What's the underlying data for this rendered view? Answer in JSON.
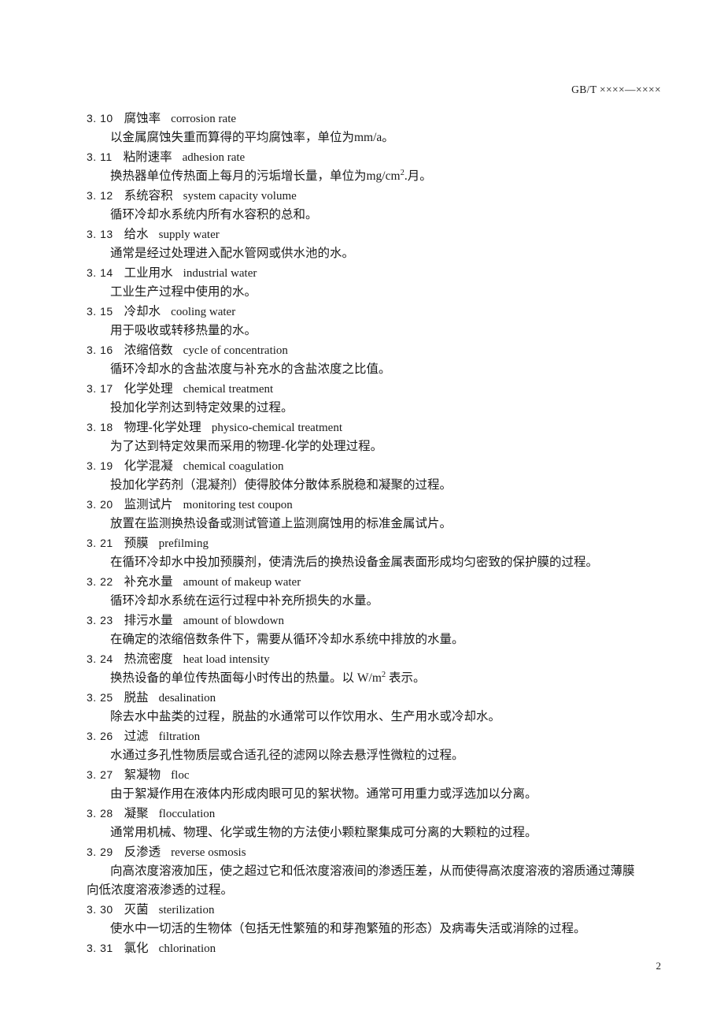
{
  "header": {
    "standard_code": "GB/T ××××—××××"
  },
  "footer": {
    "page_number": "2"
  },
  "entries": [
    {
      "number": "3. 10",
      "term_cn": "腐蚀率",
      "term_en": "corrosion rate",
      "definition_lines": [
        "以金属腐蚀失重而算得的平均腐蚀率，单位为mm/a。"
      ]
    },
    {
      "number": "3. 11",
      "term_cn": "粘附速率",
      "term_en": "adhesion rate",
      "definition_lines": [
        "换热器单位传热面上每月的污垢增长量，单位为mg/cm@SUP2@.月。"
      ]
    },
    {
      "number": "3. 12",
      "term_cn": "系统容积",
      "term_en": "system capacity volume",
      "definition_lines": [
        "循环冷却水系统内所有水容积的总和。"
      ]
    },
    {
      "number": "3. 13",
      "term_cn": "给水",
      "term_en": "supply water",
      "definition_lines": [
        "通常是经过处理进入配水管网或供水池的水。"
      ]
    },
    {
      "number": "3. 14",
      "term_cn": "工业用水",
      "term_en": "industrial water",
      "definition_lines": [
        "工业生产过程中使用的水。"
      ]
    },
    {
      "number": "3. 15",
      "term_cn": "冷却水",
      "term_en": "cooling water",
      "definition_lines": [
        "用于吸收或转移热量的水。"
      ]
    },
    {
      "number": "3. 16",
      "term_cn": "浓缩倍数",
      "term_en": "cycle of concentration",
      "definition_lines": [
        "循环冷却水的含盐浓度与补充水的含盐浓度之比值。"
      ]
    },
    {
      "number": "3. 17",
      "term_cn": "化学处理",
      "term_en": "chemical treatment",
      "definition_lines": [
        "投加化学剂达到特定效果的过程。"
      ]
    },
    {
      "number": "3. 18",
      "term_cn": "物理-化学处理",
      "term_en": "physico-chemical treatment",
      "definition_lines": [
        "为了达到特定效果而采用的物理-化学的处理过程。"
      ]
    },
    {
      "number": "3. 19",
      "term_cn": "化学混凝",
      "term_en": "chemical coagulation",
      "definition_lines": [
        "投加化学药剂（混凝剂）使得胶体分散体系脱稳和凝聚的过程。"
      ]
    },
    {
      "number": "3. 20",
      "term_cn": "监测试片",
      "term_en": "monitoring test coupon",
      "definition_lines": [
        "放置在监测换热设备或测试管道上监测腐蚀用的标准金属试片。"
      ]
    },
    {
      "number": "3. 21",
      "term_cn": "预膜",
      "term_en": "prefilming",
      "definition_lines": [
        "在循环冷却水中投加预膜剂，使清洗后的换热设备金属表面形成均匀密致的保护膜的过程。"
      ]
    },
    {
      "number": "3. 22",
      "term_cn": "补充水量",
      "term_en": "amount of makeup water",
      "definition_lines": [
        "循环冷却水系统在运行过程中补充所损失的水量。"
      ]
    },
    {
      "number": "3. 23",
      "term_cn": "排污水量",
      "term_en": "amount of blowdown",
      "definition_lines": [
        "在确定的浓缩倍数条件下，需要从循环冷却水系统中排放的水量。"
      ]
    },
    {
      "number": "3. 24",
      "term_cn": "热流密度",
      "term_en": "heat load intensity",
      "definition_lines": [
        "换热设备的单位传热面每小时传出的热量。以 W/m@SUP2@ 表示。"
      ]
    },
    {
      "number": "3. 25",
      "term_cn": "脱盐",
      "term_en": "desalination",
      "definition_lines": [
        "除去水中盐类的过程，脱盐的水通常可以作饮用水、生产用水或冷却水。"
      ]
    },
    {
      "number": "3. 26",
      "term_cn": "过滤",
      "term_en": "filtration",
      "definition_lines": [
        "水通过多孔性物质层或合适孔径的滤网以除去悬浮性微粒的过程。"
      ]
    },
    {
      "number": "3. 27",
      "term_cn": "絮凝物",
      "term_en": "floc",
      "definition_lines": [
        "由于絮凝作用在液体内形成肉眼可见的絮状物。通常可用重力或浮选加以分离。"
      ]
    },
    {
      "number": "3. 28",
      "term_cn": "凝聚",
      "term_en": "flocculation",
      "definition_lines": [
        "通常用机械、物理、化学或生物的方法使小颗粒聚集成可分离的大颗粒的过程。"
      ]
    },
    {
      "number": "3. 29",
      "term_cn": "反渗透",
      "term_en": "reverse osmosis",
      "definition_lines": [
        "向高浓度溶液加压，使之超过它和低浓度溶液间的渗透压差，从而使得高浓度溶液的溶质通过薄膜",
        "向低浓度溶液渗透的过程。"
      ]
    },
    {
      "number": "3. 30",
      "term_cn": "灭菌",
      "term_en": "sterilization",
      "definition_lines": [
        "使水中一切活的生物体（包括无性繁殖的和芽孢繁殖的形态）及病毒失活或消除的过程。"
      ]
    },
    {
      "number": "3. 31",
      "term_cn": "氯化",
      "term_en": "chlorination",
      "definition_lines": []
    }
  ]
}
